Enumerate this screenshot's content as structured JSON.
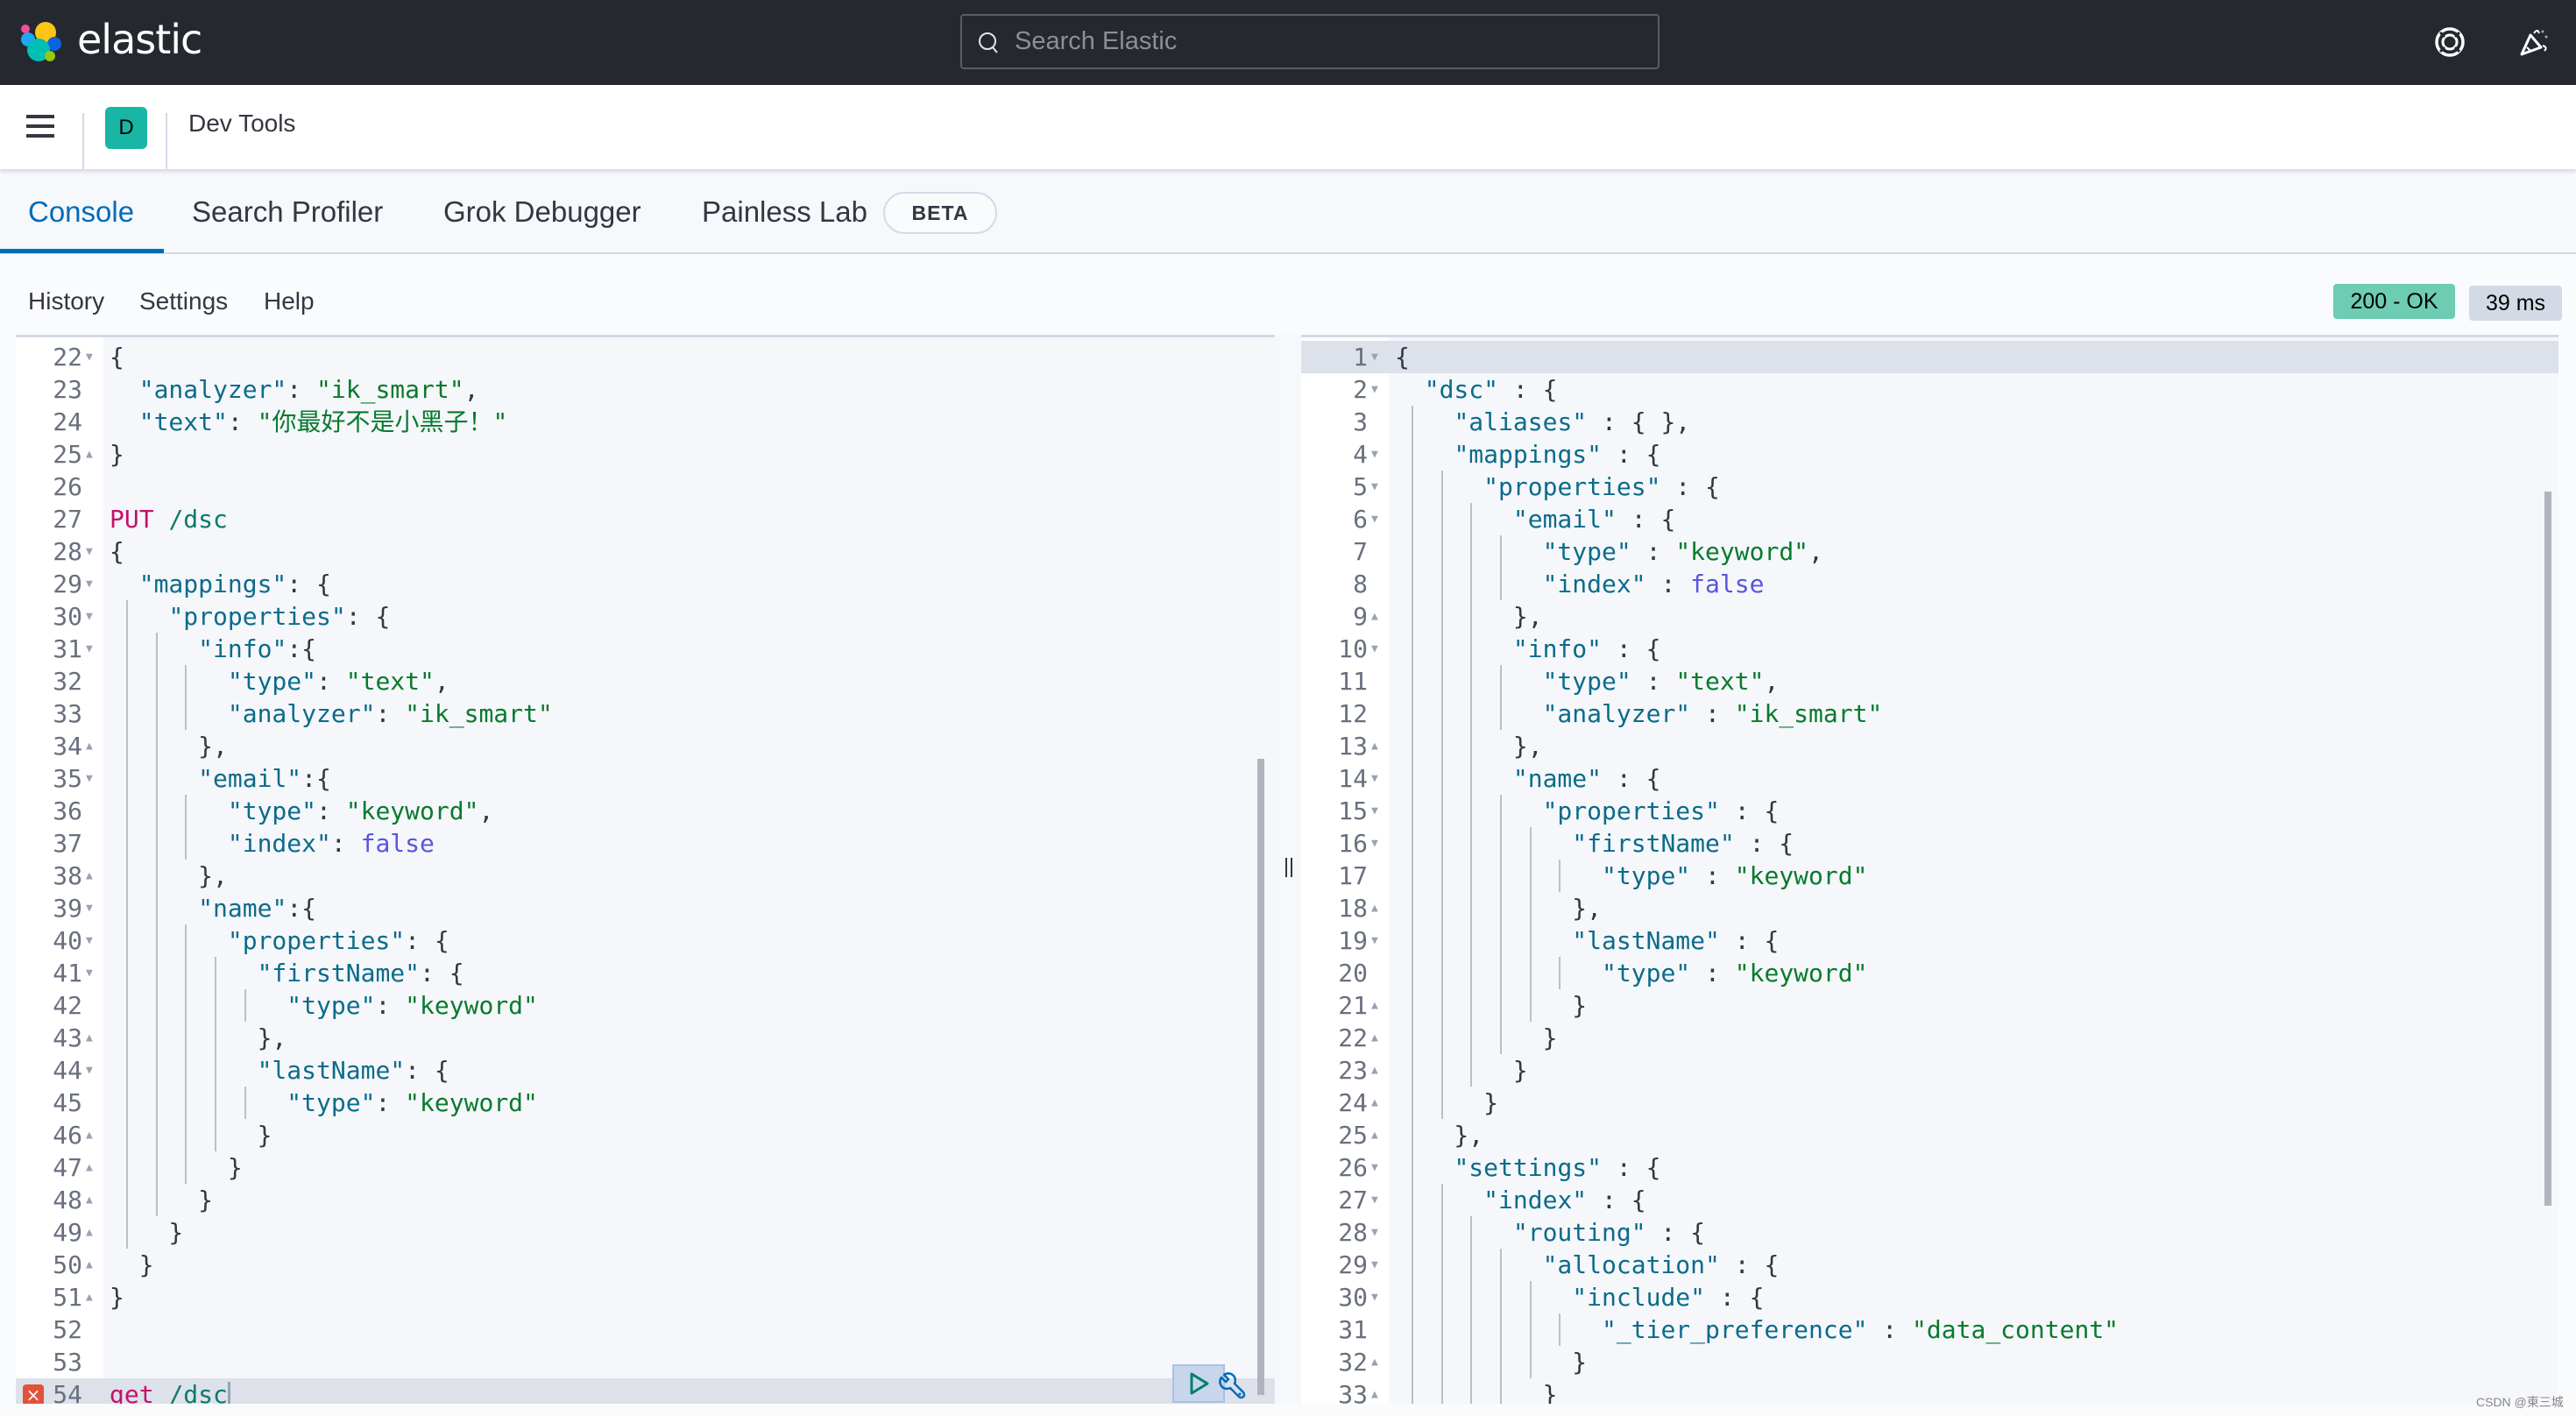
{
  "header": {
    "logo_text": "elastic",
    "search_placeholder": "Search Elastic",
    "help_icon": "lifebuoy-icon",
    "news_icon": "party-popper-icon"
  },
  "breadcrumb": {
    "space_initial": "D",
    "title": "Dev Tools"
  },
  "tabs": [
    {
      "label": "Console",
      "active": true
    },
    {
      "label": "Search Profiler",
      "active": false
    },
    {
      "label": "Grok Debugger",
      "active": false
    },
    {
      "label": "Painless Lab",
      "active": false,
      "badge": "BETA"
    }
  ],
  "toolbar": {
    "history": "History",
    "settings": "Settings",
    "help": "Help",
    "status": "200 - OK",
    "status_color": "#6dccb1",
    "duration": "39 ms"
  },
  "request_editor": {
    "error_line": 54,
    "lines": [
      {
        "n": "22",
        "fold": "open",
        "tokens": [
          [
            "p",
            "{"
          ]
        ]
      },
      {
        "n": "23",
        "fold": "",
        "tokens": [
          [
            "p",
            "  "
          ],
          [
            "k",
            "\"analyzer\""
          ],
          [
            "p",
            ": "
          ],
          [
            "s",
            "\"ik_smart\""
          ],
          [
            "p",
            ","
          ]
        ]
      },
      {
        "n": "24",
        "fold": "",
        "tokens": [
          [
            "p",
            "  "
          ],
          [
            "k",
            "\"text\""
          ],
          [
            "p",
            ": "
          ],
          [
            "s",
            "\"你最好不是小黑子！\""
          ]
        ]
      },
      {
        "n": "25",
        "fold": "close",
        "tokens": [
          [
            "p",
            "}"
          ]
        ]
      },
      {
        "n": "26",
        "fold": "",
        "tokens": []
      },
      {
        "n": "27",
        "fold": "",
        "tokens": [
          [
            "m",
            "PUT"
          ],
          [
            "p",
            " "
          ],
          [
            "u",
            "/dsc"
          ]
        ]
      },
      {
        "n": "28",
        "fold": "open",
        "tokens": [
          [
            "p",
            "{"
          ]
        ]
      },
      {
        "n": "29",
        "fold": "open",
        "tokens": [
          [
            "p",
            "  "
          ],
          [
            "k",
            "\"mappings\""
          ],
          [
            "p",
            ": {"
          ]
        ]
      },
      {
        "n": "30",
        "fold": "open",
        "guides": 1,
        "tokens": [
          [
            "p",
            "    "
          ],
          [
            "k",
            "\"properties\""
          ],
          [
            "p",
            ": {"
          ]
        ]
      },
      {
        "n": "31",
        "fold": "open",
        "guides": 2,
        "tokens": [
          [
            "p",
            "      "
          ],
          [
            "k",
            "\"info\""
          ],
          [
            "p",
            ":{"
          ]
        ]
      },
      {
        "n": "32",
        "fold": "",
        "guides": 3,
        "tokens": [
          [
            "p",
            "        "
          ],
          [
            "k",
            "\"type\""
          ],
          [
            "p",
            ": "
          ],
          [
            "s",
            "\"text\""
          ],
          [
            "p",
            ","
          ]
        ]
      },
      {
        "n": "33",
        "fold": "",
        "guides": 3,
        "tokens": [
          [
            "p",
            "        "
          ],
          [
            "k",
            "\"analyzer\""
          ],
          [
            "p",
            ": "
          ],
          [
            "s",
            "\"ik_smart\""
          ]
        ]
      },
      {
        "n": "34",
        "fold": "close",
        "guides": 2,
        "tokens": [
          [
            "p",
            "      },"
          ]
        ]
      },
      {
        "n": "35",
        "fold": "open",
        "guides": 2,
        "tokens": [
          [
            "p",
            "      "
          ],
          [
            "k",
            "\"email\""
          ],
          [
            "p",
            ":{"
          ]
        ]
      },
      {
        "n": "36",
        "fold": "",
        "guides": 3,
        "tokens": [
          [
            "p",
            "        "
          ],
          [
            "k",
            "\"type\""
          ],
          [
            "p",
            ": "
          ],
          [
            "s",
            "\"keyword\""
          ],
          [
            "p",
            ","
          ]
        ]
      },
      {
        "n": "37",
        "fold": "",
        "guides": 3,
        "tokens": [
          [
            "p",
            "        "
          ],
          [
            "k",
            "\"index\""
          ],
          [
            "p",
            ": "
          ],
          [
            "b",
            "false"
          ]
        ]
      },
      {
        "n": "38",
        "fold": "close",
        "guides": 2,
        "tokens": [
          [
            "p",
            "      },"
          ]
        ]
      },
      {
        "n": "39",
        "fold": "open",
        "guides": 2,
        "tokens": [
          [
            "p",
            "      "
          ],
          [
            "k",
            "\"name\""
          ],
          [
            "p",
            ":{"
          ]
        ]
      },
      {
        "n": "40",
        "fold": "open",
        "guides": 3,
        "tokens": [
          [
            "p",
            "        "
          ],
          [
            "k",
            "\"properties\""
          ],
          [
            "p",
            ": {"
          ]
        ]
      },
      {
        "n": "41",
        "fold": "open",
        "guides": 4,
        "tokens": [
          [
            "p",
            "          "
          ],
          [
            "k",
            "\"firstName\""
          ],
          [
            "p",
            ": {"
          ]
        ]
      },
      {
        "n": "42",
        "fold": "",
        "guides": 5,
        "tokens": [
          [
            "p",
            "            "
          ],
          [
            "k",
            "\"type\""
          ],
          [
            "p",
            ": "
          ],
          [
            "s",
            "\"keyword\""
          ]
        ]
      },
      {
        "n": "43",
        "fold": "close",
        "guides": 4,
        "tokens": [
          [
            "p",
            "          },"
          ]
        ]
      },
      {
        "n": "44",
        "fold": "open",
        "guides": 4,
        "tokens": [
          [
            "p",
            "          "
          ],
          [
            "k",
            "\"lastName\""
          ],
          [
            "p",
            ": {"
          ]
        ]
      },
      {
        "n": "45",
        "fold": "",
        "guides": 5,
        "tokens": [
          [
            "p",
            "            "
          ],
          [
            "k",
            "\"type\""
          ],
          [
            "p",
            ": "
          ],
          [
            "s",
            "\"keyword\""
          ]
        ]
      },
      {
        "n": "46",
        "fold": "close",
        "guides": 4,
        "tokens": [
          [
            "p",
            "          }"
          ]
        ]
      },
      {
        "n": "47",
        "fold": "close",
        "guides": 3,
        "tokens": [
          [
            "p",
            "        }"
          ]
        ]
      },
      {
        "n": "48",
        "fold": "close",
        "guides": 2,
        "tokens": [
          [
            "p",
            "      }"
          ]
        ]
      },
      {
        "n": "49",
        "fold": "close",
        "guides": 1,
        "tokens": [
          [
            "p",
            "    }"
          ]
        ]
      },
      {
        "n": "50",
        "fold": "close",
        "tokens": [
          [
            "p",
            "  }"
          ]
        ]
      },
      {
        "n": "51",
        "fold": "close",
        "tokens": [
          [
            "p",
            "}"
          ]
        ]
      },
      {
        "n": "52",
        "fold": "",
        "tokens": []
      },
      {
        "n": "53",
        "fold": "",
        "tokens": []
      },
      {
        "n": "54",
        "fold": "",
        "error": true,
        "current": true,
        "tokens": [
          [
            "m",
            "get"
          ],
          [
            "p",
            " "
          ],
          [
            "u",
            "/dsc"
          ]
        ]
      }
    ]
  },
  "response_editor": {
    "lines": [
      {
        "n": "1",
        "fold": "open",
        "current": true,
        "tokens": [
          [
            "p",
            "{"
          ]
        ]
      },
      {
        "n": "2",
        "fold": "open",
        "tokens": [
          [
            "p",
            "  "
          ],
          [
            "k",
            "\"dsc\""
          ],
          [
            "p",
            " : {"
          ]
        ]
      },
      {
        "n": "3",
        "fold": "",
        "guides": 1,
        "tokens": [
          [
            "p",
            "    "
          ],
          [
            "k",
            "\"aliases\""
          ],
          [
            "p",
            " : { },"
          ]
        ]
      },
      {
        "n": "4",
        "fold": "open",
        "guides": 1,
        "tokens": [
          [
            "p",
            "    "
          ],
          [
            "k",
            "\"mappings\""
          ],
          [
            "p",
            " : {"
          ]
        ]
      },
      {
        "n": "5",
        "fold": "open",
        "guides": 2,
        "tokens": [
          [
            "p",
            "      "
          ],
          [
            "k",
            "\"properties\""
          ],
          [
            "p",
            " : {"
          ]
        ]
      },
      {
        "n": "6",
        "fold": "open",
        "guides": 3,
        "tokens": [
          [
            "p",
            "        "
          ],
          [
            "k",
            "\"email\""
          ],
          [
            "p",
            " : {"
          ]
        ]
      },
      {
        "n": "7",
        "fold": "",
        "guides": 4,
        "tokens": [
          [
            "p",
            "          "
          ],
          [
            "k",
            "\"type\""
          ],
          [
            "p",
            " : "
          ],
          [
            "s",
            "\"keyword\""
          ],
          [
            "p",
            ","
          ]
        ]
      },
      {
        "n": "8",
        "fold": "",
        "guides": 4,
        "tokens": [
          [
            "p",
            "          "
          ],
          [
            "k",
            "\"index\""
          ],
          [
            "p",
            " : "
          ],
          [
            "b",
            "false"
          ]
        ]
      },
      {
        "n": "9",
        "fold": "close",
        "guides": 3,
        "tokens": [
          [
            "p",
            "        },"
          ]
        ]
      },
      {
        "n": "10",
        "fold": "open",
        "guides": 3,
        "tokens": [
          [
            "p",
            "        "
          ],
          [
            "k",
            "\"info\""
          ],
          [
            "p",
            " : {"
          ]
        ]
      },
      {
        "n": "11",
        "fold": "",
        "guides": 4,
        "tokens": [
          [
            "p",
            "          "
          ],
          [
            "k",
            "\"type\""
          ],
          [
            "p",
            " : "
          ],
          [
            "s",
            "\"text\""
          ],
          [
            "p",
            ","
          ]
        ]
      },
      {
        "n": "12",
        "fold": "",
        "guides": 4,
        "tokens": [
          [
            "p",
            "          "
          ],
          [
            "k",
            "\"analyzer\""
          ],
          [
            "p",
            " : "
          ],
          [
            "s",
            "\"ik_smart\""
          ]
        ]
      },
      {
        "n": "13",
        "fold": "close",
        "guides": 3,
        "tokens": [
          [
            "p",
            "        },"
          ]
        ]
      },
      {
        "n": "14",
        "fold": "open",
        "guides": 3,
        "tokens": [
          [
            "p",
            "        "
          ],
          [
            "k",
            "\"name\""
          ],
          [
            "p",
            " : {"
          ]
        ]
      },
      {
        "n": "15",
        "fold": "open",
        "guides": 4,
        "tokens": [
          [
            "p",
            "          "
          ],
          [
            "k",
            "\"properties\""
          ],
          [
            "p",
            " : {"
          ]
        ]
      },
      {
        "n": "16",
        "fold": "open",
        "guides": 5,
        "tokens": [
          [
            "p",
            "            "
          ],
          [
            "k",
            "\"firstName\""
          ],
          [
            "p",
            " : {"
          ]
        ]
      },
      {
        "n": "17",
        "fold": "",
        "guides": 6,
        "tokens": [
          [
            "p",
            "              "
          ],
          [
            "k",
            "\"type\""
          ],
          [
            "p",
            " : "
          ],
          [
            "s",
            "\"keyword\""
          ]
        ]
      },
      {
        "n": "18",
        "fold": "close",
        "guides": 5,
        "tokens": [
          [
            "p",
            "            },"
          ]
        ]
      },
      {
        "n": "19",
        "fold": "open",
        "guides": 5,
        "tokens": [
          [
            "p",
            "            "
          ],
          [
            "k",
            "\"lastName\""
          ],
          [
            "p",
            " : {"
          ]
        ]
      },
      {
        "n": "20",
        "fold": "",
        "guides": 6,
        "tokens": [
          [
            "p",
            "              "
          ],
          [
            "k",
            "\"type\""
          ],
          [
            "p",
            " : "
          ],
          [
            "s",
            "\"keyword\""
          ]
        ]
      },
      {
        "n": "21",
        "fold": "close",
        "guides": 5,
        "tokens": [
          [
            "p",
            "            }"
          ]
        ]
      },
      {
        "n": "22",
        "fold": "close",
        "guides": 4,
        "tokens": [
          [
            "p",
            "          }"
          ]
        ]
      },
      {
        "n": "23",
        "fold": "close",
        "guides": 3,
        "tokens": [
          [
            "p",
            "        }"
          ]
        ]
      },
      {
        "n": "24",
        "fold": "close",
        "guides": 2,
        "tokens": [
          [
            "p",
            "      }"
          ]
        ]
      },
      {
        "n": "25",
        "fold": "close",
        "guides": 1,
        "tokens": [
          [
            "p",
            "    },"
          ]
        ]
      },
      {
        "n": "26",
        "fold": "open",
        "guides": 1,
        "tokens": [
          [
            "p",
            "    "
          ],
          [
            "k",
            "\"settings\""
          ],
          [
            "p",
            " : {"
          ]
        ]
      },
      {
        "n": "27",
        "fold": "open",
        "guides": 2,
        "tokens": [
          [
            "p",
            "      "
          ],
          [
            "k",
            "\"index\""
          ],
          [
            "p",
            " : {"
          ]
        ]
      },
      {
        "n": "28",
        "fold": "open",
        "guides": 3,
        "tokens": [
          [
            "p",
            "        "
          ],
          [
            "k",
            "\"routing\""
          ],
          [
            "p",
            " : {"
          ]
        ]
      },
      {
        "n": "29",
        "fold": "open",
        "guides": 4,
        "tokens": [
          [
            "p",
            "          "
          ],
          [
            "k",
            "\"allocation\""
          ],
          [
            "p",
            " : {"
          ]
        ]
      },
      {
        "n": "30",
        "fold": "open",
        "guides": 5,
        "tokens": [
          [
            "p",
            "            "
          ],
          [
            "k",
            "\"include\""
          ],
          [
            "p",
            " : {"
          ]
        ]
      },
      {
        "n": "31",
        "fold": "",
        "guides": 6,
        "tokens": [
          [
            "p",
            "              "
          ],
          [
            "k",
            "\"_tier_preference\""
          ],
          [
            "p",
            " : "
          ],
          [
            "s",
            "\"data_content\""
          ]
        ]
      },
      {
        "n": "32",
        "fold": "close",
        "guides": 5,
        "tokens": [
          [
            "p",
            "            }"
          ]
        ]
      },
      {
        "n": "33",
        "fold": "close",
        "guides": 4,
        "tokens": [
          [
            "p",
            "          }"
          ]
        ]
      }
    ]
  },
  "watermark": "CSDN @東三城"
}
